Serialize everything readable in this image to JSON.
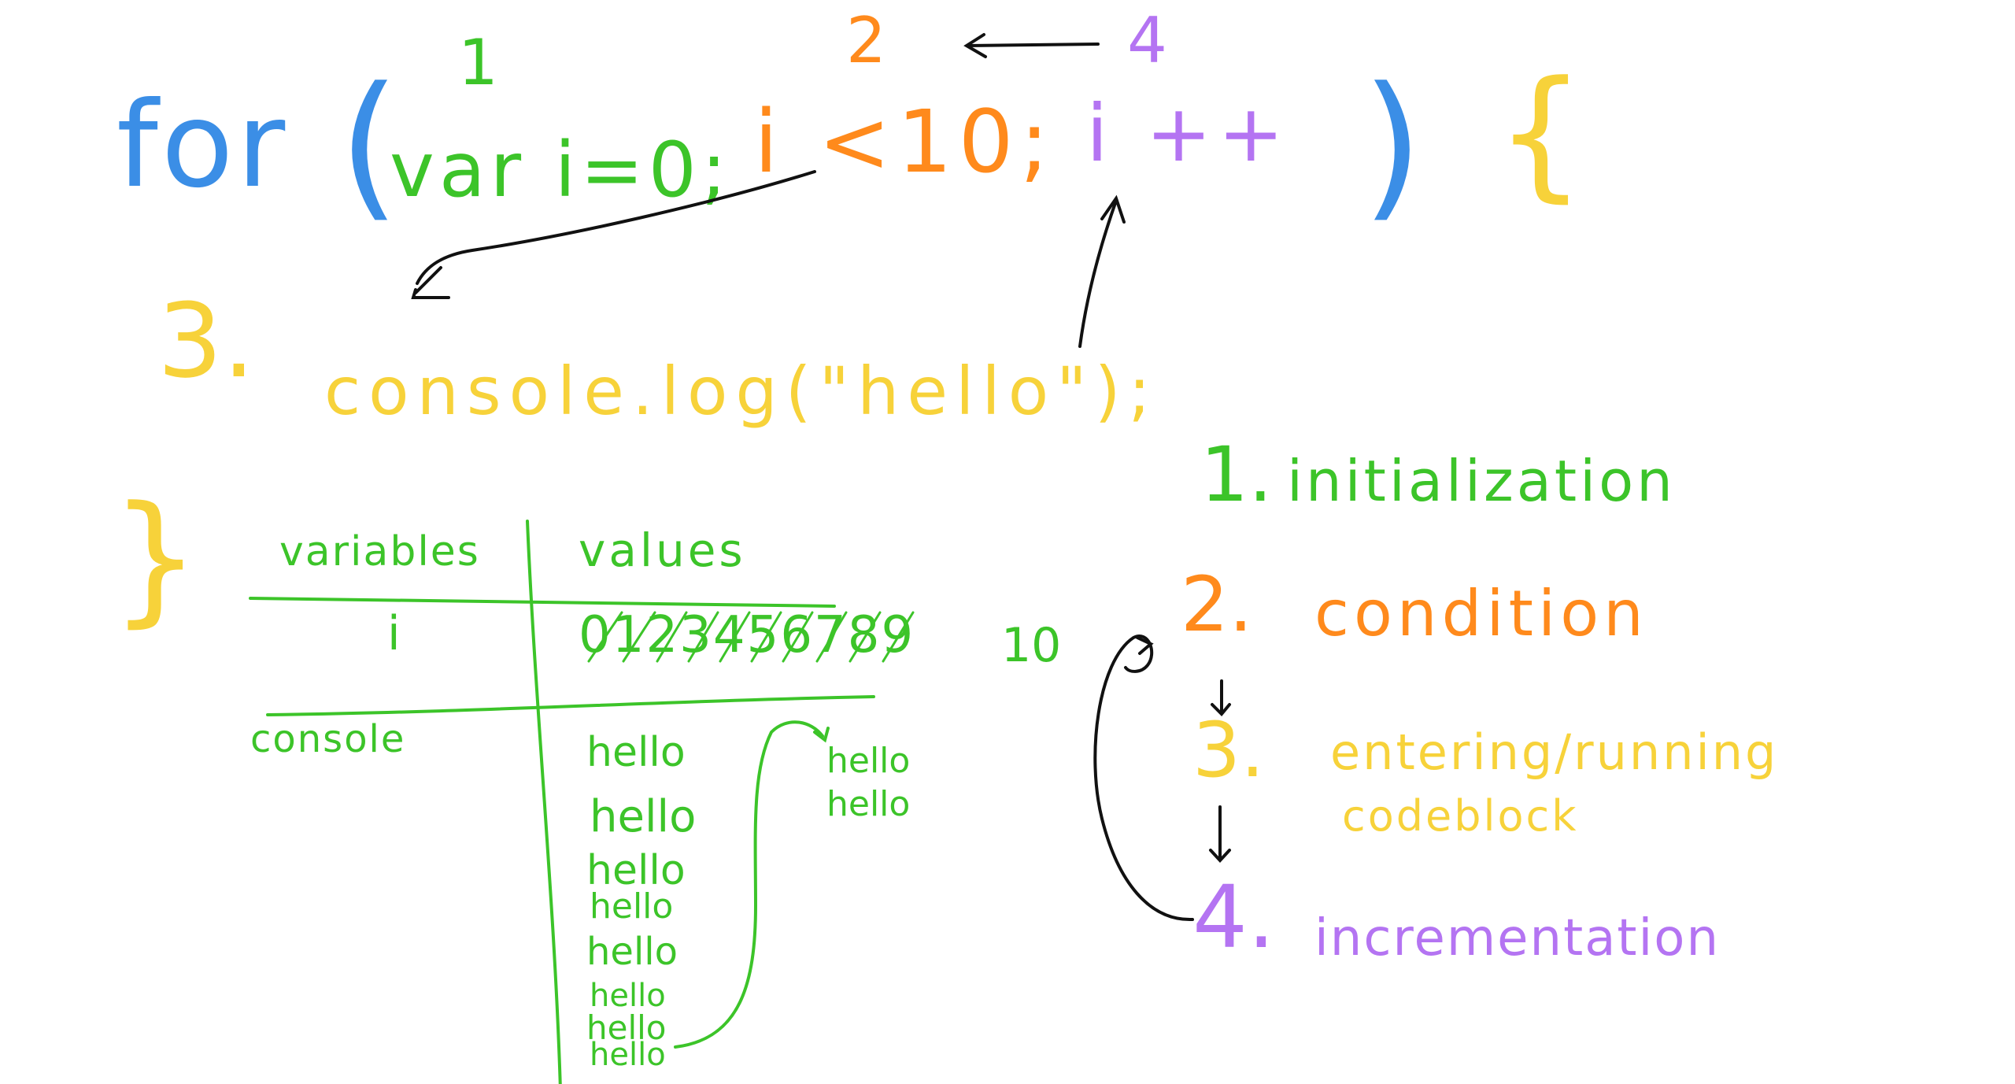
{
  "colors": {
    "keyword_blue": "#3b8ee6",
    "init_green": "#3cc429",
    "condition_orange": "#ff8a1c",
    "body_yellow": "#f7d23a",
    "increment_purple": "#b474f2",
    "arrow_black": "#111111",
    "background": "#ffffff"
  },
  "code": {
    "keyword": "for",
    "paren_open": "(",
    "init": "var i=0;",
    "condition": "i <10;",
    "increment": "i ++",
    "paren_close": ")",
    "brace_open": "{",
    "body": "console.log(\"hello\");",
    "brace_close": "}"
  },
  "step_numbers": {
    "init": "1",
    "condition": "2",
    "body": "3.",
    "increment": "4"
  },
  "table": {
    "headers": [
      "variables",
      "values"
    ],
    "variable": "i",
    "crossed_values": "0123456789",
    "final_value": "10",
    "console_label": "console",
    "console_output": [
      "hello",
      "hello",
      "hello",
      "hello",
      "hello",
      "hello",
      "hello",
      "hello"
    ],
    "extra_output": [
      "hello",
      "hello"
    ]
  },
  "legend": [
    {
      "number": "1.",
      "label": "initialization"
    },
    {
      "number": "2.",
      "label": "condition"
    },
    {
      "number": "3.",
      "label": "entering/running",
      "label2": "codeblock"
    },
    {
      "number": "4.",
      "label": "incrementation"
    }
  ]
}
